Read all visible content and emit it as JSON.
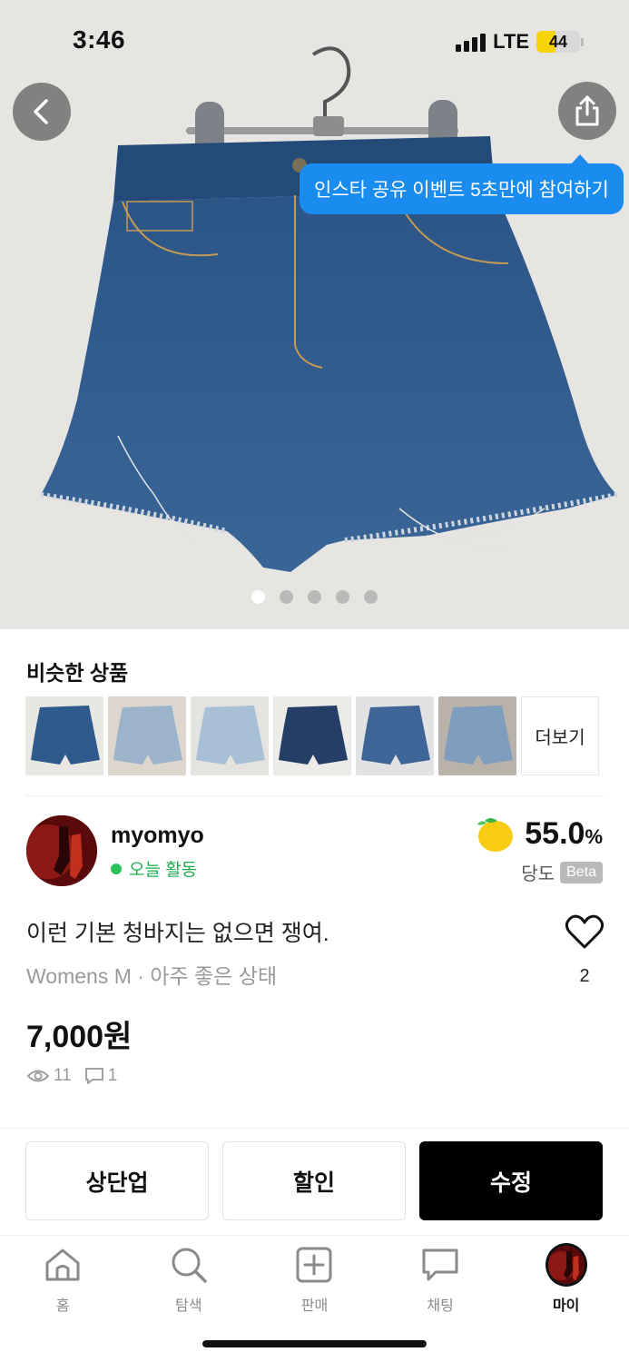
{
  "status_bar": {
    "time": "3:46",
    "network": "LTE",
    "battery": "44",
    "battery_level": 0.44
  },
  "hero": {
    "back_icon": "chevron-left-icon",
    "share_icon": "share-icon",
    "promo_text": "인스타 공유 이벤트 5초만에 참여하기",
    "image_count": 5,
    "active_image": 1
  },
  "similar": {
    "title": "비슷한 상품",
    "more_label": "더보기",
    "items": [
      {
        "denim": "#2f5a8c",
        "bg": "#e9e7e2"
      },
      {
        "denim": "#9bb4cc",
        "bg": "#ddd6cc"
      },
      {
        "denim": "#a8c0d6",
        "bg": "#e5e3df"
      },
      {
        "denim": "#253e66",
        "bg": "#ecebe8"
      },
      {
        "denim": "#3e6596",
        "bg": "#e2e2e4"
      },
      {
        "denim": "#7f9dbd",
        "bg": "#b9b2a8"
      }
    ]
  },
  "seller": {
    "name": "myomyo",
    "activity": "오늘 활동",
    "temperature": "55.0",
    "temperature_unit": "%",
    "temperature_label": "당도",
    "beta_label": "Beta",
    "temperature_icon": "lemon-icon"
  },
  "product": {
    "title": "이런 기본 청바지는 없으면 쟁여.",
    "meta": "Womens M · 아주 좋은 상태",
    "price": "7,000원",
    "likes": "2",
    "views": "11",
    "chats": "1"
  },
  "actions": {
    "bump": "상단업",
    "discount": "할인",
    "edit": "수정"
  },
  "tabbar": {
    "items": [
      {
        "label": "홈",
        "icon": "home-icon"
      },
      {
        "label": "탐색",
        "icon": "search-icon"
      },
      {
        "label": "판매",
        "icon": "plus-square-icon"
      },
      {
        "label": "채팅",
        "icon": "chat-icon"
      },
      {
        "label": "마이",
        "icon": "profile-avatar-icon"
      }
    ],
    "active": "마이"
  },
  "colors": {
    "accent_blue": "#1a8cf0",
    "active_green": "#1fae4e",
    "primary_button": "#000000"
  }
}
